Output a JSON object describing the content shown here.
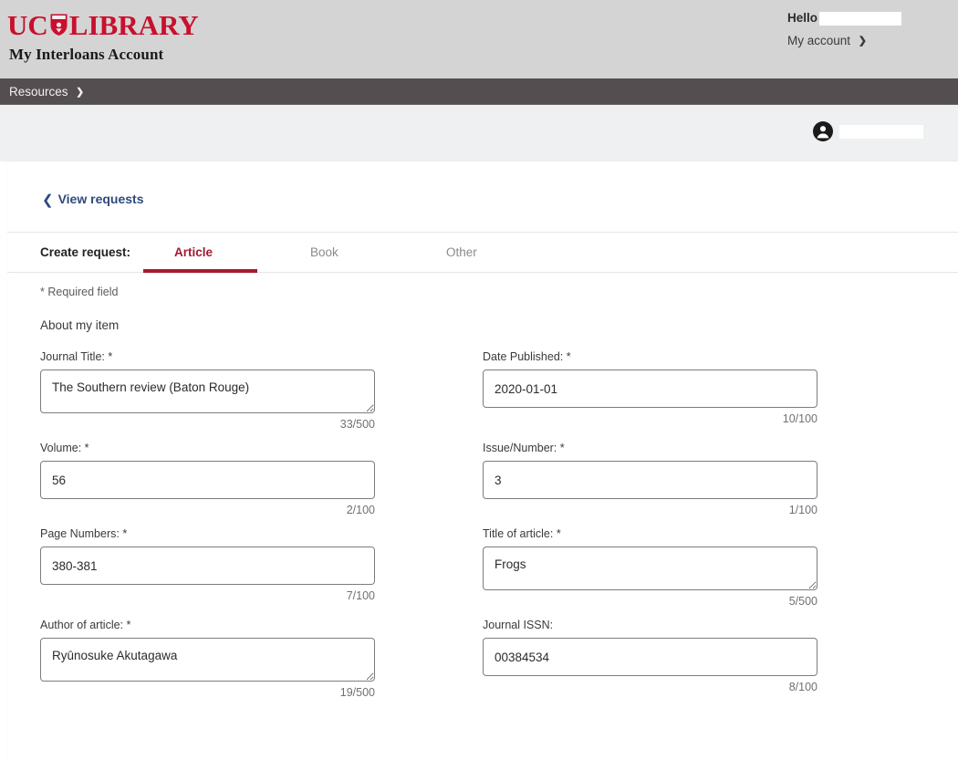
{
  "brand": {
    "logo_uc": "UC",
    "logo_library": "LIBRARY",
    "crest_icon": "shield-crest-icon",
    "subtitle": "My Interloans Account"
  },
  "account": {
    "hello_label": "Hello",
    "hello_name_redacted": "",
    "my_account_label": "My account",
    "caret_icon": "chevron-down-icon"
  },
  "navbar": {
    "items": [
      {
        "label": "Resources",
        "caret_icon": "chevron-down-icon"
      }
    ]
  },
  "user_strip": {
    "avatar_icon": "person-icon",
    "user_name_redacted": ""
  },
  "card": {
    "back_link": {
      "label": "View requests",
      "chevron_icon": "chevron-left-icon"
    },
    "tabs": {
      "label": "Create request:",
      "items": [
        {
          "label": "Article",
          "active": true
        },
        {
          "label": "Book",
          "active": false
        },
        {
          "label": "Other",
          "active": false
        }
      ]
    },
    "form": {
      "required_note": "* Required field",
      "section_title": "About my item",
      "fields": [
        {
          "name": "journal-title",
          "label": "Journal Title:",
          "required": "*",
          "value": "The Southern review (Baton Rouge)",
          "counter": "33/500",
          "control": "textarea"
        },
        {
          "name": "date-published",
          "label": "Date Published:",
          "required": "*",
          "value": "2020-01-01",
          "counter": "10/100",
          "control": "input"
        },
        {
          "name": "volume",
          "label": "Volume:",
          "required": "*",
          "value": "56",
          "counter": "2/100",
          "control": "input"
        },
        {
          "name": "issue-number",
          "label": "Issue/Number:",
          "required": "*",
          "value": "3",
          "counter": "1/100",
          "control": "input"
        },
        {
          "name": "page-numbers",
          "label": "Page Numbers:",
          "required": "*",
          "value": "380-381",
          "counter": "7/100",
          "control": "input"
        },
        {
          "name": "title-of-article",
          "label": "Title of article:",
          "required": "*",
          "value": "Frogs",
          "counter": "5/500",
          "control": "textarea"
        },
        {
          "name": "author-of-article",
          "label": "Author of article:",
          "required": "*",
          "value": "Ryūnosuke Akutagawa",
          "counter": "19/500",
          "control": "textarea"
        },
        {
          "name": "journal-issn",
          "label": "Journal ISSN:",
          "required": "",
          "value": "00384534",
          "counter": "8/100",
          "control": "input"
        }
      ]
    }
  },
  "colors": {
    "brand_red": "#c8102e",
    "tab_red": "#a6192e",
    "link_blue": "#2c4a7c",
    "nav_dark": "#544e51",
    "band_gray": "#d4d4d4",
    "strip_gray": "#eef0f2"
  }
}
